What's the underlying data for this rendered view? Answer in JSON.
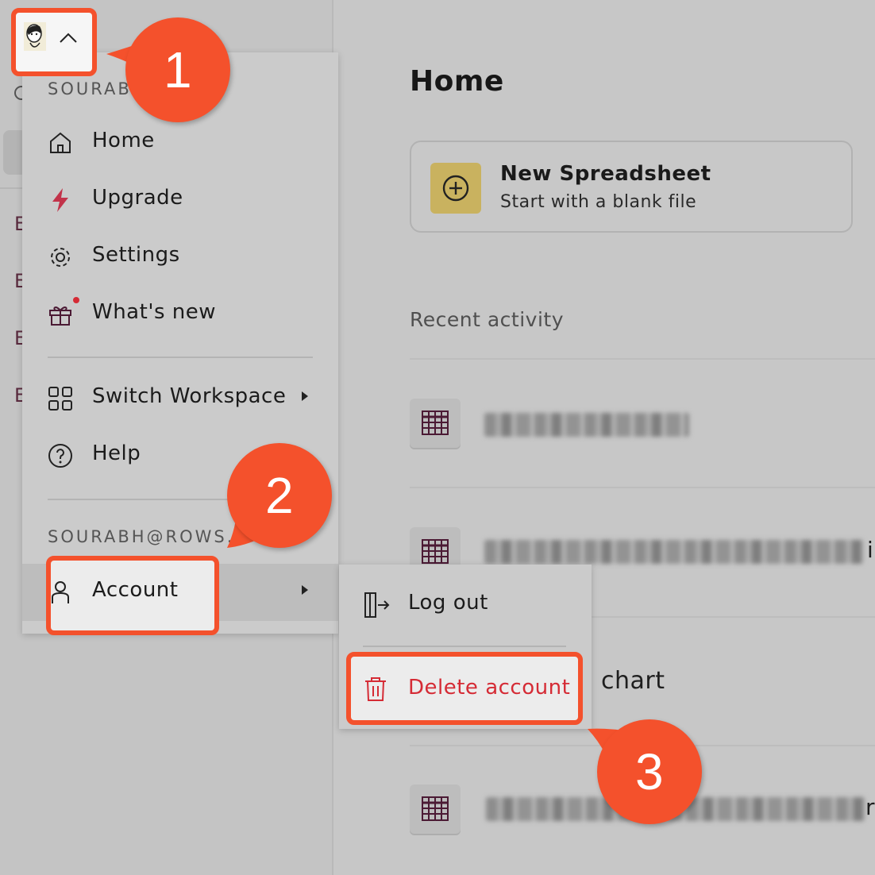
{
  "sidebar": {
    "letters": [
      "E",
      "E",
      "E",
      "E"
    ]
  },
  "main": {
    "title": "Home",
    "new_card": {
      "title": "New Spreadsheet",
      "subtitle": "Start with a blank file"
    },
    "recent_label": "Recent activity",
    "partial_row_text": "chart",
    "partial_row_suffix": "i",
    "partial_row_suffix2": "r"
  },
  "menu": {
    "user_short": "SOURABH",
    "items": [
      {
        "label": "Home",
        "icon": "home-icon"
      },
      {
        "label": "Upgrade",
        "icon": "lightning-icon"
      },
      {
        "label": "Settings",
        "icon": "gear-icon"
      },
      {
        "label": "What's new",
        "icon": "gift-icon"
      }
    ],
    "switch_workspace": "Switch Workspace",
    "help": "Help",
    "email": "SOURABH@ROWS.",
    "account": "Account"
  },
  "submenu": {
    "logout": "Log out",
    "delete": "Delete account"
  },
  "callouts": [
    "1",
    "2",
    "3"
  ],
  "colors": {
    "annotation": "#f4512c",
    "delete_red": "#d52b35",
    "new_icon_bg": "#c9b25f",
    "upgrade_icon": "#c2334a"
  }
}
